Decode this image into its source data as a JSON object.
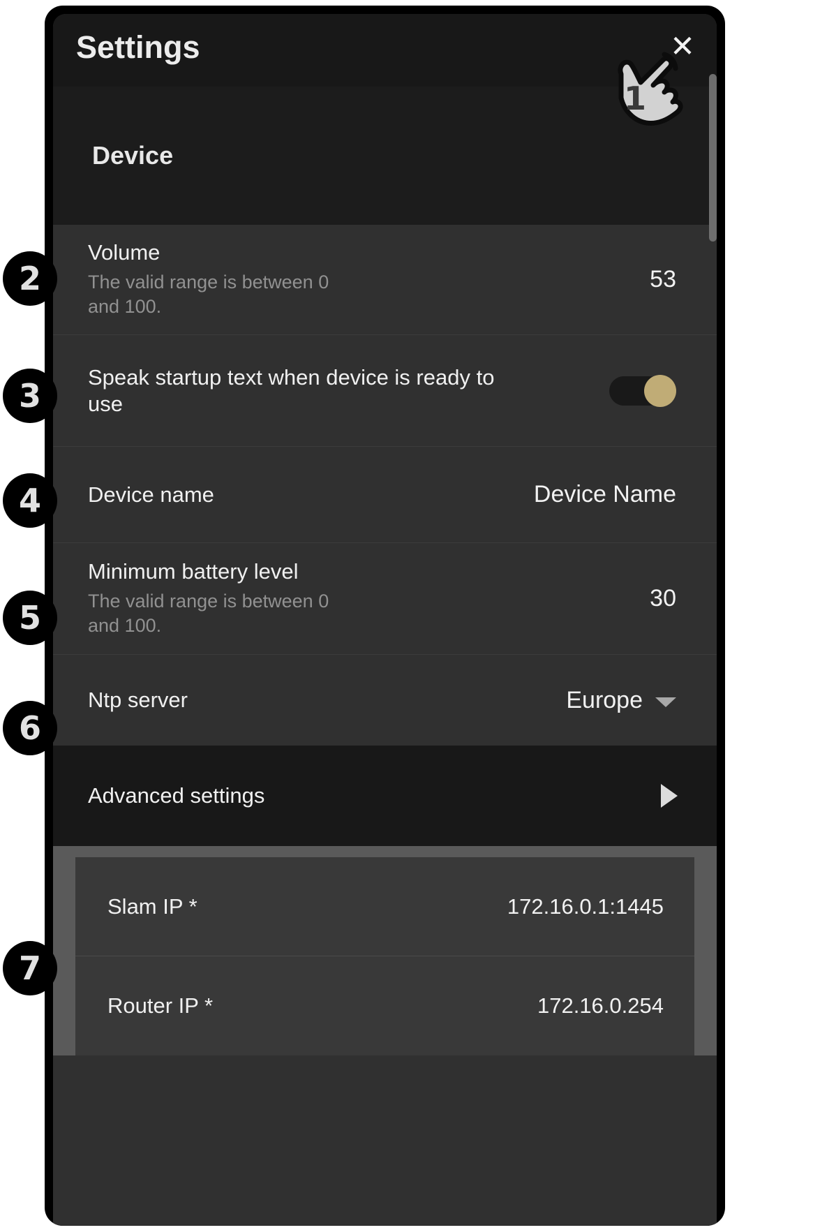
{
  "dialog": {
    "title": "Settings",
    "close_icon": "close-icon",
    "close_label": "✕"
  },
  "section": {
    "label": "Device"
  },
  "annotations": {
    "hand": {
      "number": "1",
      "icon": "pointing-hand-icon",
      "target": "close-button"
    },
    "badges": [
      {
        "number": "2",
        "target": "volume-row"
      },
      {
        "number": "3",
        "target": "speak-startup-row"
      },
      {
        "number": "4",
        "target": "device-name-row"
      },
      {
        "number": "5",
        "target": "minimum-battery-row"
      },
      {
        "number": "6",
        "target": "ntp-server-row"
      },
      {
        "number": "7",
        "target": "advanced-ip-card"
      }
    ]
  },
  "rows": {
    "volume": {
      "label": "Volume",
      "subtitle": "The valid range is between 0 and 100.",
      "value": "53"
    },
    "speak_startup": {
      "label": "Speak startup text when device is ready to use",
      "toggle_state": "on"
    },
    "device_name": {
      "label": "Device name",
      "value": "Device Name"
    },
    "minimum_battery": {
      "label": "Minimum battery level",
      "subtitle": "The valid range is between 0 and 100.",
      "value": "30"
    },
    "ntp_server": {
      "label": "Ntp server",
      "value": "Europe",
      "caret_icon": "chevron-down-icon"
    },
    "advanced_settings": {
      "label": "Advanced settings",
      "arrow_icon": "triangle-right-icon"
    }
  },
  "advanced_card": {
    "items": [
      {
        "label": "Slam IP *",
        "value": "172.16.0.1:1445"
      },
      {
        "label": "Router IP *",
        "value": "172.16.0.254"
      }
    ]
  },
  "colors": {
    "accent_toggle": "#c0ac76",
    "header_bg": "#181818",
    "row_bg": "#303030",
    "card_bg": "#393939"
  }
}
